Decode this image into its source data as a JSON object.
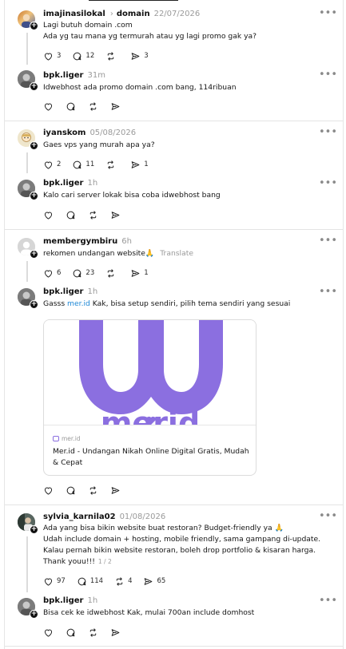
{
  "threads": [
    {
      "post": {
        "user": "imajinasilokal",
        "community": "domain",
        "time": "22/07/2026",
        "lines": [
          "Lagi butuh domain .com",
          "Ada yg tau mana yg termurah atau yg lagi promo gak ya?"
        ],
        "likes": "3",
        "comments": "12",
        "shares": "3"
      },
      "reply": {
        "user": "bpk.liger",
        "time": "31m",
        "text": "Idwebhost ada promo domain .com bang, 114ribuan"
      }
    },
    {
      "post": {
        "user": "iyanskom",
        "time": "05/08/2026",
        "lines": [
          "Gaes vps yang murah apa ya?"
        ],
        "likes": "2",
        "comments": "11",
        "shares": "1"
      },
      "reply": {
        "user": "bpk.liger",
        "time": "1h",
        "text": "Kalo cari server lokak bisa coba idwebhost bang"
      }
    },
    {
      "post": {
        "user": "membergymbiru",
        "time": "6h",
        "text": "rekomen undangan website🙏",
        "translate": "Translate",
        "likes": "6",
        "comments": "23",
        "shares": "1"
      },
      "reply": {
        "user": "bpk.liger",
        "time": "1h",
        "text_pre": "Gasss ",
        "text_link": "mer.id",
        "text_post": " Kak, bisa setup sendiri, pilih tema sendiri yang sesuai",
        "card": {
          "domain": "mer.id",
          "title": "Mer.id - Undangan Nikah Online Digital Gratis, Mudah & Cepat",
          "logo_text": "merid"
        }
      }
    },
    {
      "post": {
        "user": "sylvia_karnila02",
        "time": "01/08/2026",
        "lines": [
          "Ada yang bisa bikin website buat restoran? Budget-friendly ya 🙏",
          "Udah include domain + hosting, mobile friendly, sama gampang di-update.",
          "Kalau pernah bikin website restoran, boleh drop portfolio & kisaran harga.",
          "Thank youu!!!"
        ],
        "pager": "1 / 2",
        "likes": "97",
        "comments": "114",
        "reposts": "4",
        "shares": "65"
      },
      "reply": {
        "user": "bpk.liger",
        "time": "1h",
        "text": "Bisa cek ke idwebhost Kak, mulai 700an include domhost"
      }
    }
  ],
  "icons": {
    "like": "heart-icon",
    "comment": "comment-bubble-icon",
    "repost": "repost-arrows-icon",
    "share": "send-paper-plane-icon",
    "more": "more-dots-icon",
    "follow": "follow-plus-icon"
  },
  "colors": {
    "link": "#1e88d6",
    "muted": "#9a9a9a",
    "logo_purple": "#8b6fe0"
  }
}
